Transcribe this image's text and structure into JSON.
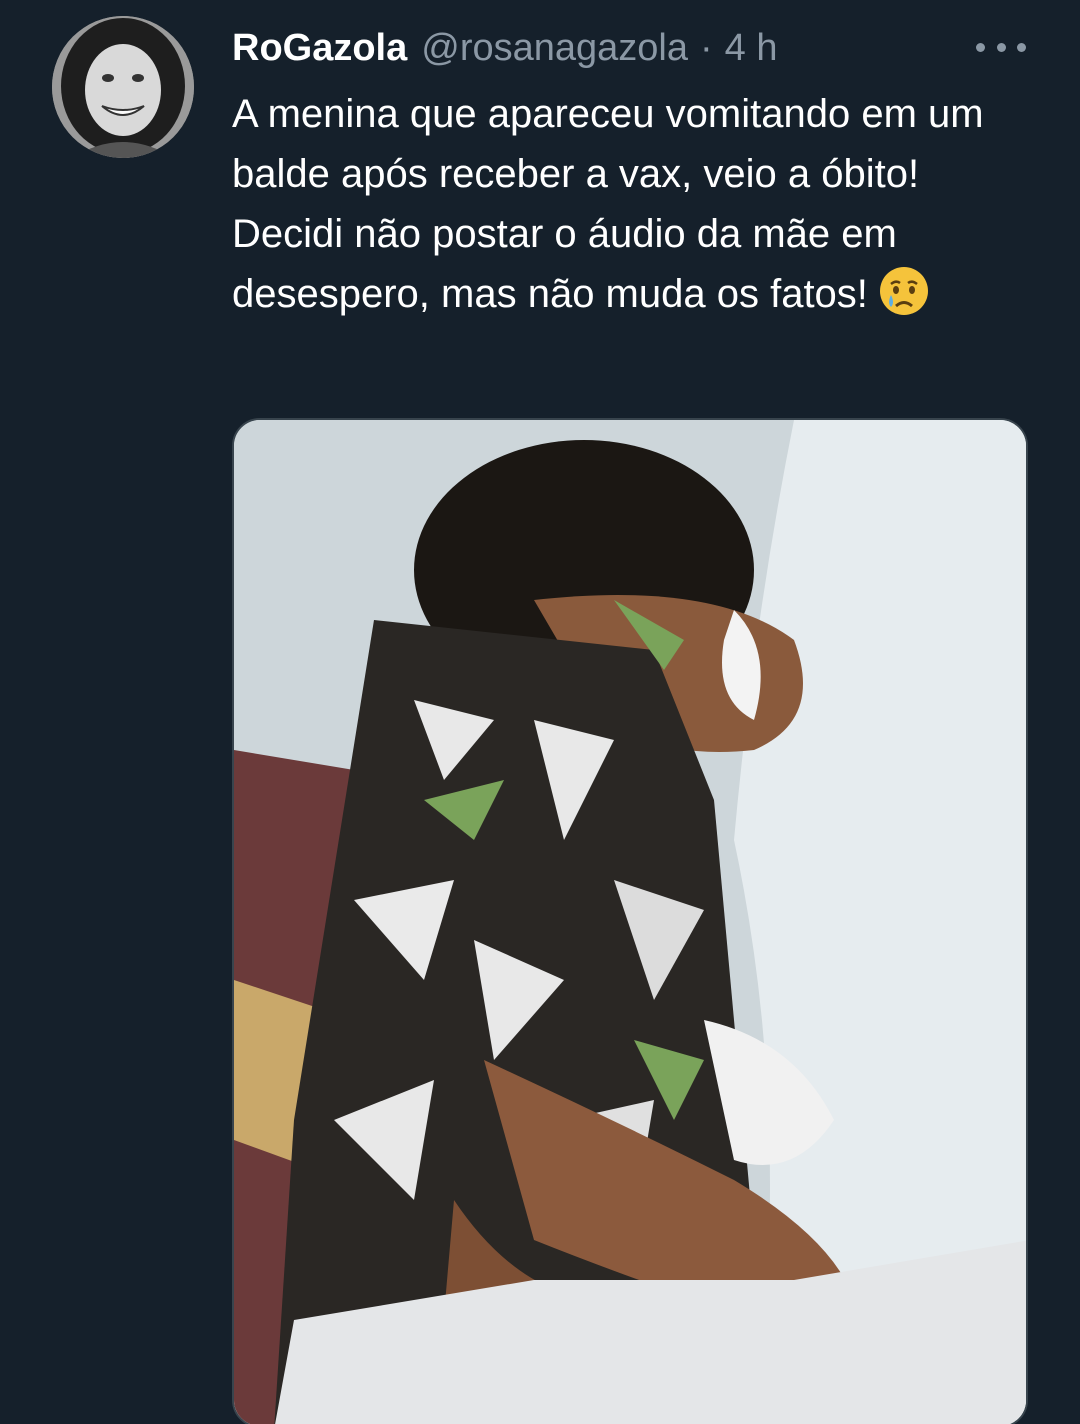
{
  "tweet": {
    "display_name": "RoGazola",
    "handle": "@rosanagazola",
    "separator": "·",
    "time": "4 h",
    "text": "A menina que apareceu vomitando em um balde após receber a vax, veio a óbito! Decidi não postar o áudio da mãe em desespero, mas não muda os fatos!",
    "emoji": "crying-face-icon"
  },
  "colors": {
    "background": "#15202b",
    "secondary_text": "#8b98a5",
    "border": "#38444d"
  }
}
